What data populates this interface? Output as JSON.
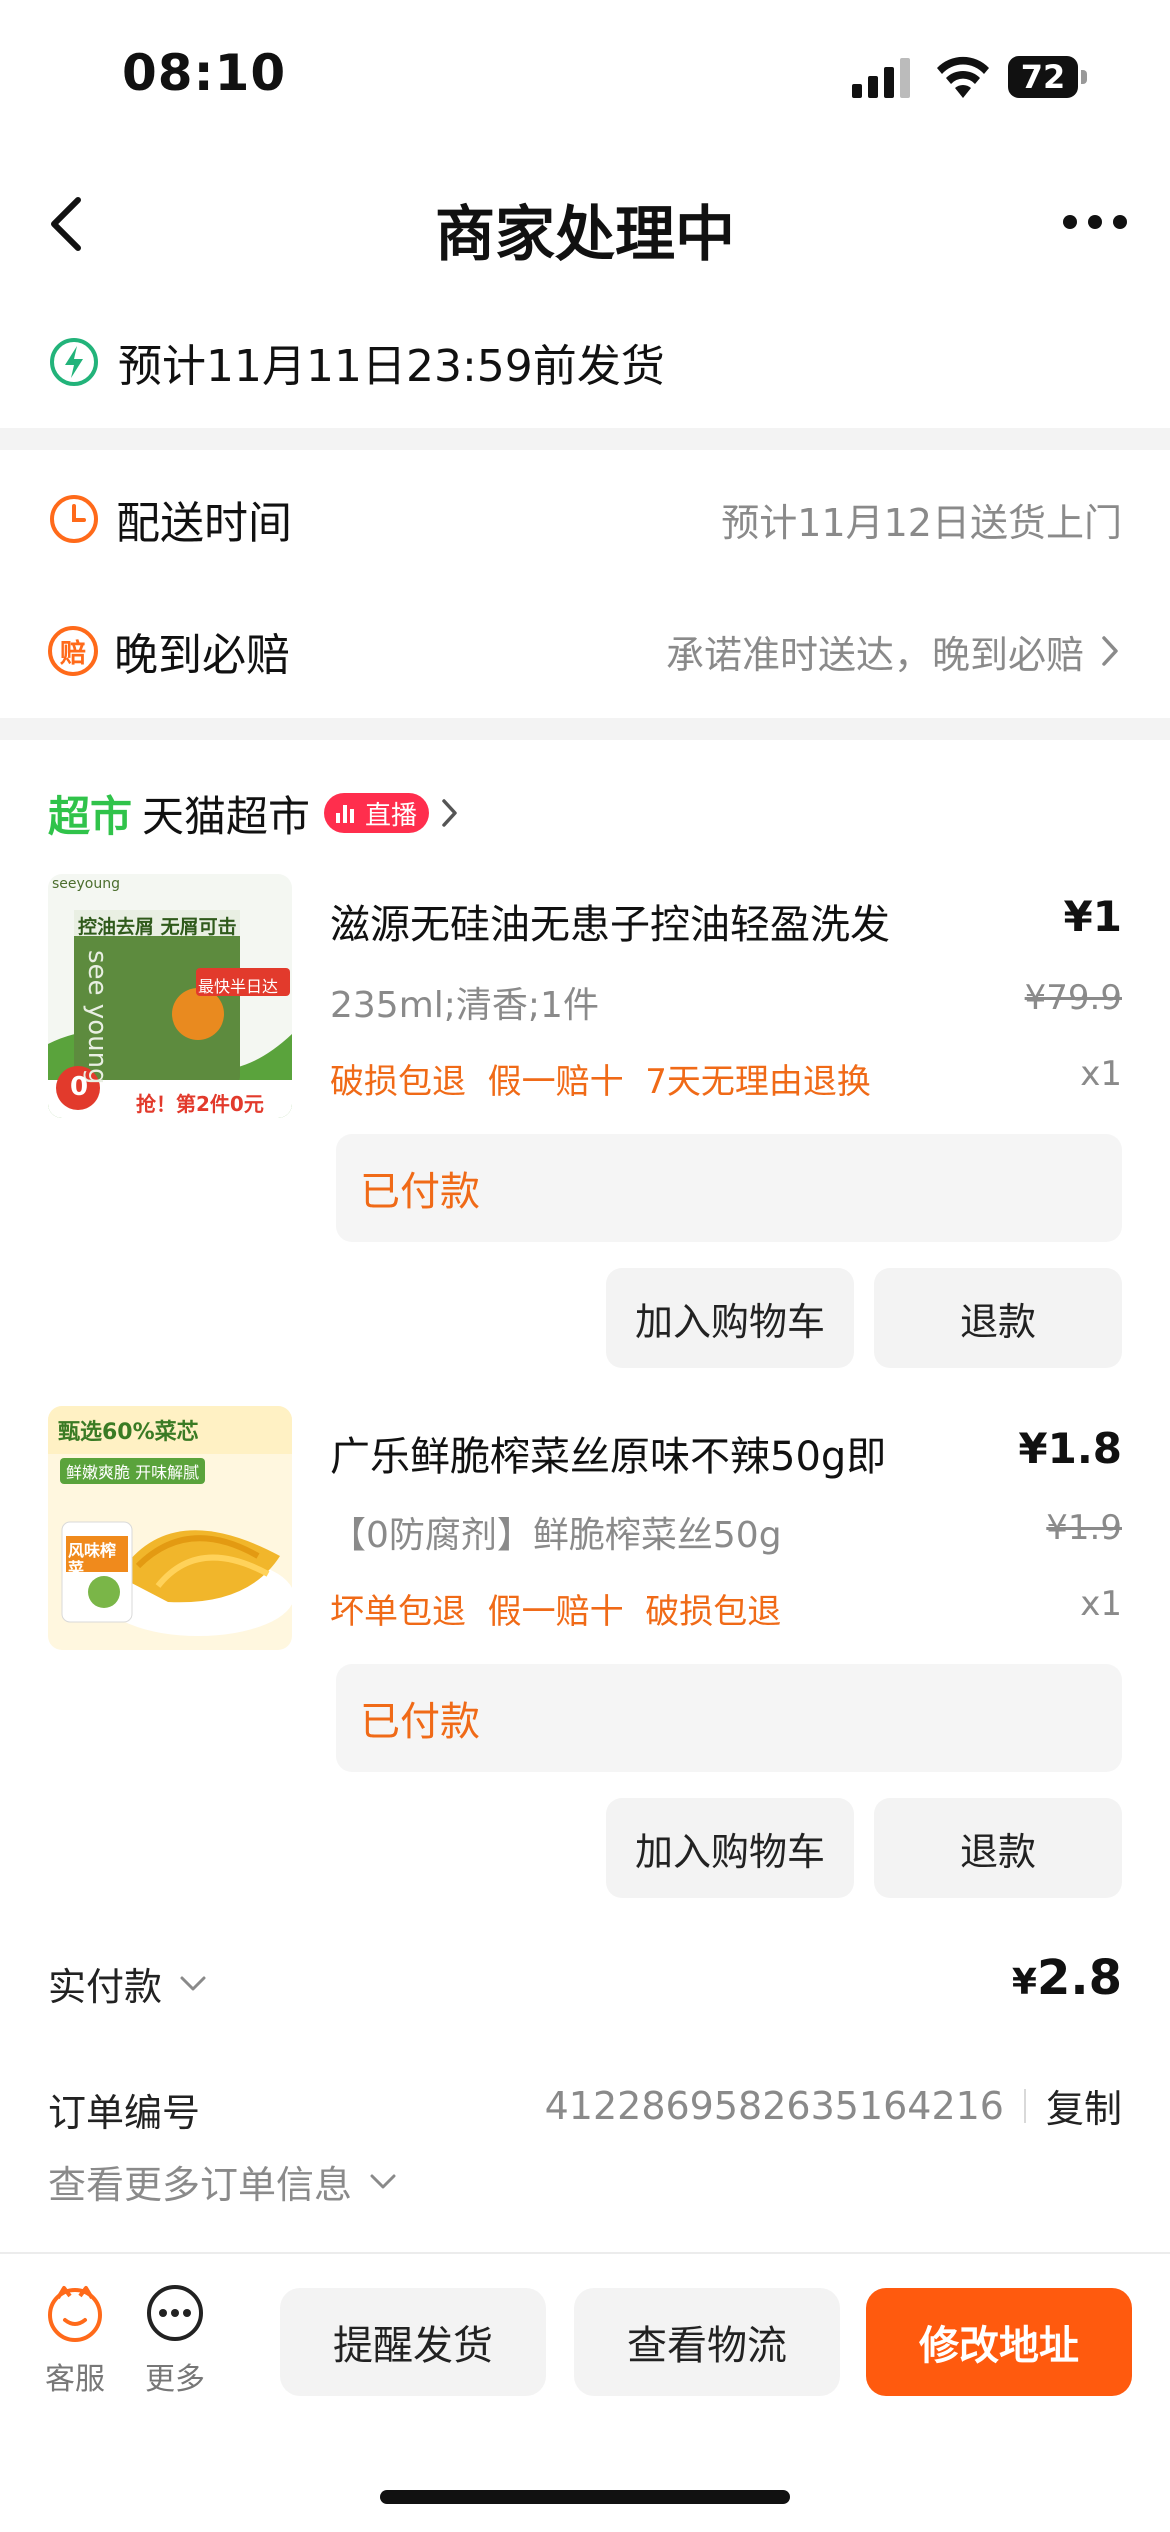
{
  "status_bar": {
    "time": "08:10",
    "battery": "72"
  },
  "nav": {
    "title": "商家处理中"
  },
  "shipping": {
    "text": "预计11月11日23:59前发货"
  },
  "delivery": {
    "time_label": "配送时间",
    "time_value": "预计11月12日送货上门",
    "late_label": "晚到必赔",
    "late_icon_char": "赔",
    "late_value": "承诺准时送达，晚到必赔"
  },
  "store": {
    "logo": "超市",
    "name": "天猫超市",
    "live_badge": "直播"
  },
  "products": [
    {
      "title": "滋源无硅油无患子控油轻盈洗发",
      "spec": "235ml;清香;1件",
      "promos": "破损包退  假一赔十  7天无理由退换",
      "price_symbol": "¥",
      "price": "1",
      "old_price": "¥79.9",
      "qty": "x1",
      "status": "已付款",
      "add_cart": "加入购物车",
      "refund": "退款",
      "thumb": {
        "brand": "seeyoung",
        "head": "控油去屑 无屑可击",
        "tag": "最快半日达",
        "vertical": "see young",
        "promo": "抢！第2件0元",
        "zero": "0"
      }
    },
    {
      "title": "广乐鲜脆榨菜丝原味不辣50g即",
      "spec": "【0防腐剂】鲜脆榨菜丝50g",
      "promos": "坏单包退  假一赔十  破损包退",
      "price_symbol": "¥",
      "price": "1.8",
      "old_price": "¥1.9",
      "qty": "x1",
      "status": "已付款",
      "add_cart": "加入购物车",
      "refund": "退款",
      "thumb": {
        "head": "甄选60%菜芯",
        "sub": "鲜嫩爽脆 开味解腻",
        "pack": "风味榨菜"
      }
    }
  ],
  "summary": {
    "paid_label": "实付款",
    "paid_symbol": "¥",
    "paid_value": "2.8",
    "order_label": "订单编号",
    "order_no": "4122869582635164216",
    "copy": "复制",
    "more_info": "查看更多订单信息"
  },
  "bottom": {
    "service": "客服",
    "more": "更多",
    "remind": "提醒发货",
    "logistics": "查看物流",
    "modify": "修改地址"
  },
  "colors": {
    "accent": "#ff6a1a",
    "promo": "#f06a17",
    "green": "#30c34a",
    "live": "#ff2e4d"
  },
  "icons": [
    "back-icon",
    "more-icon",
    "lightning-icon",
    "clock-icon",
    "compensation-icon",
    "chevron-right-icon",
    "chevron-down-icon",
    "service-icon",
    "more-circle-icon"
  ]
}
